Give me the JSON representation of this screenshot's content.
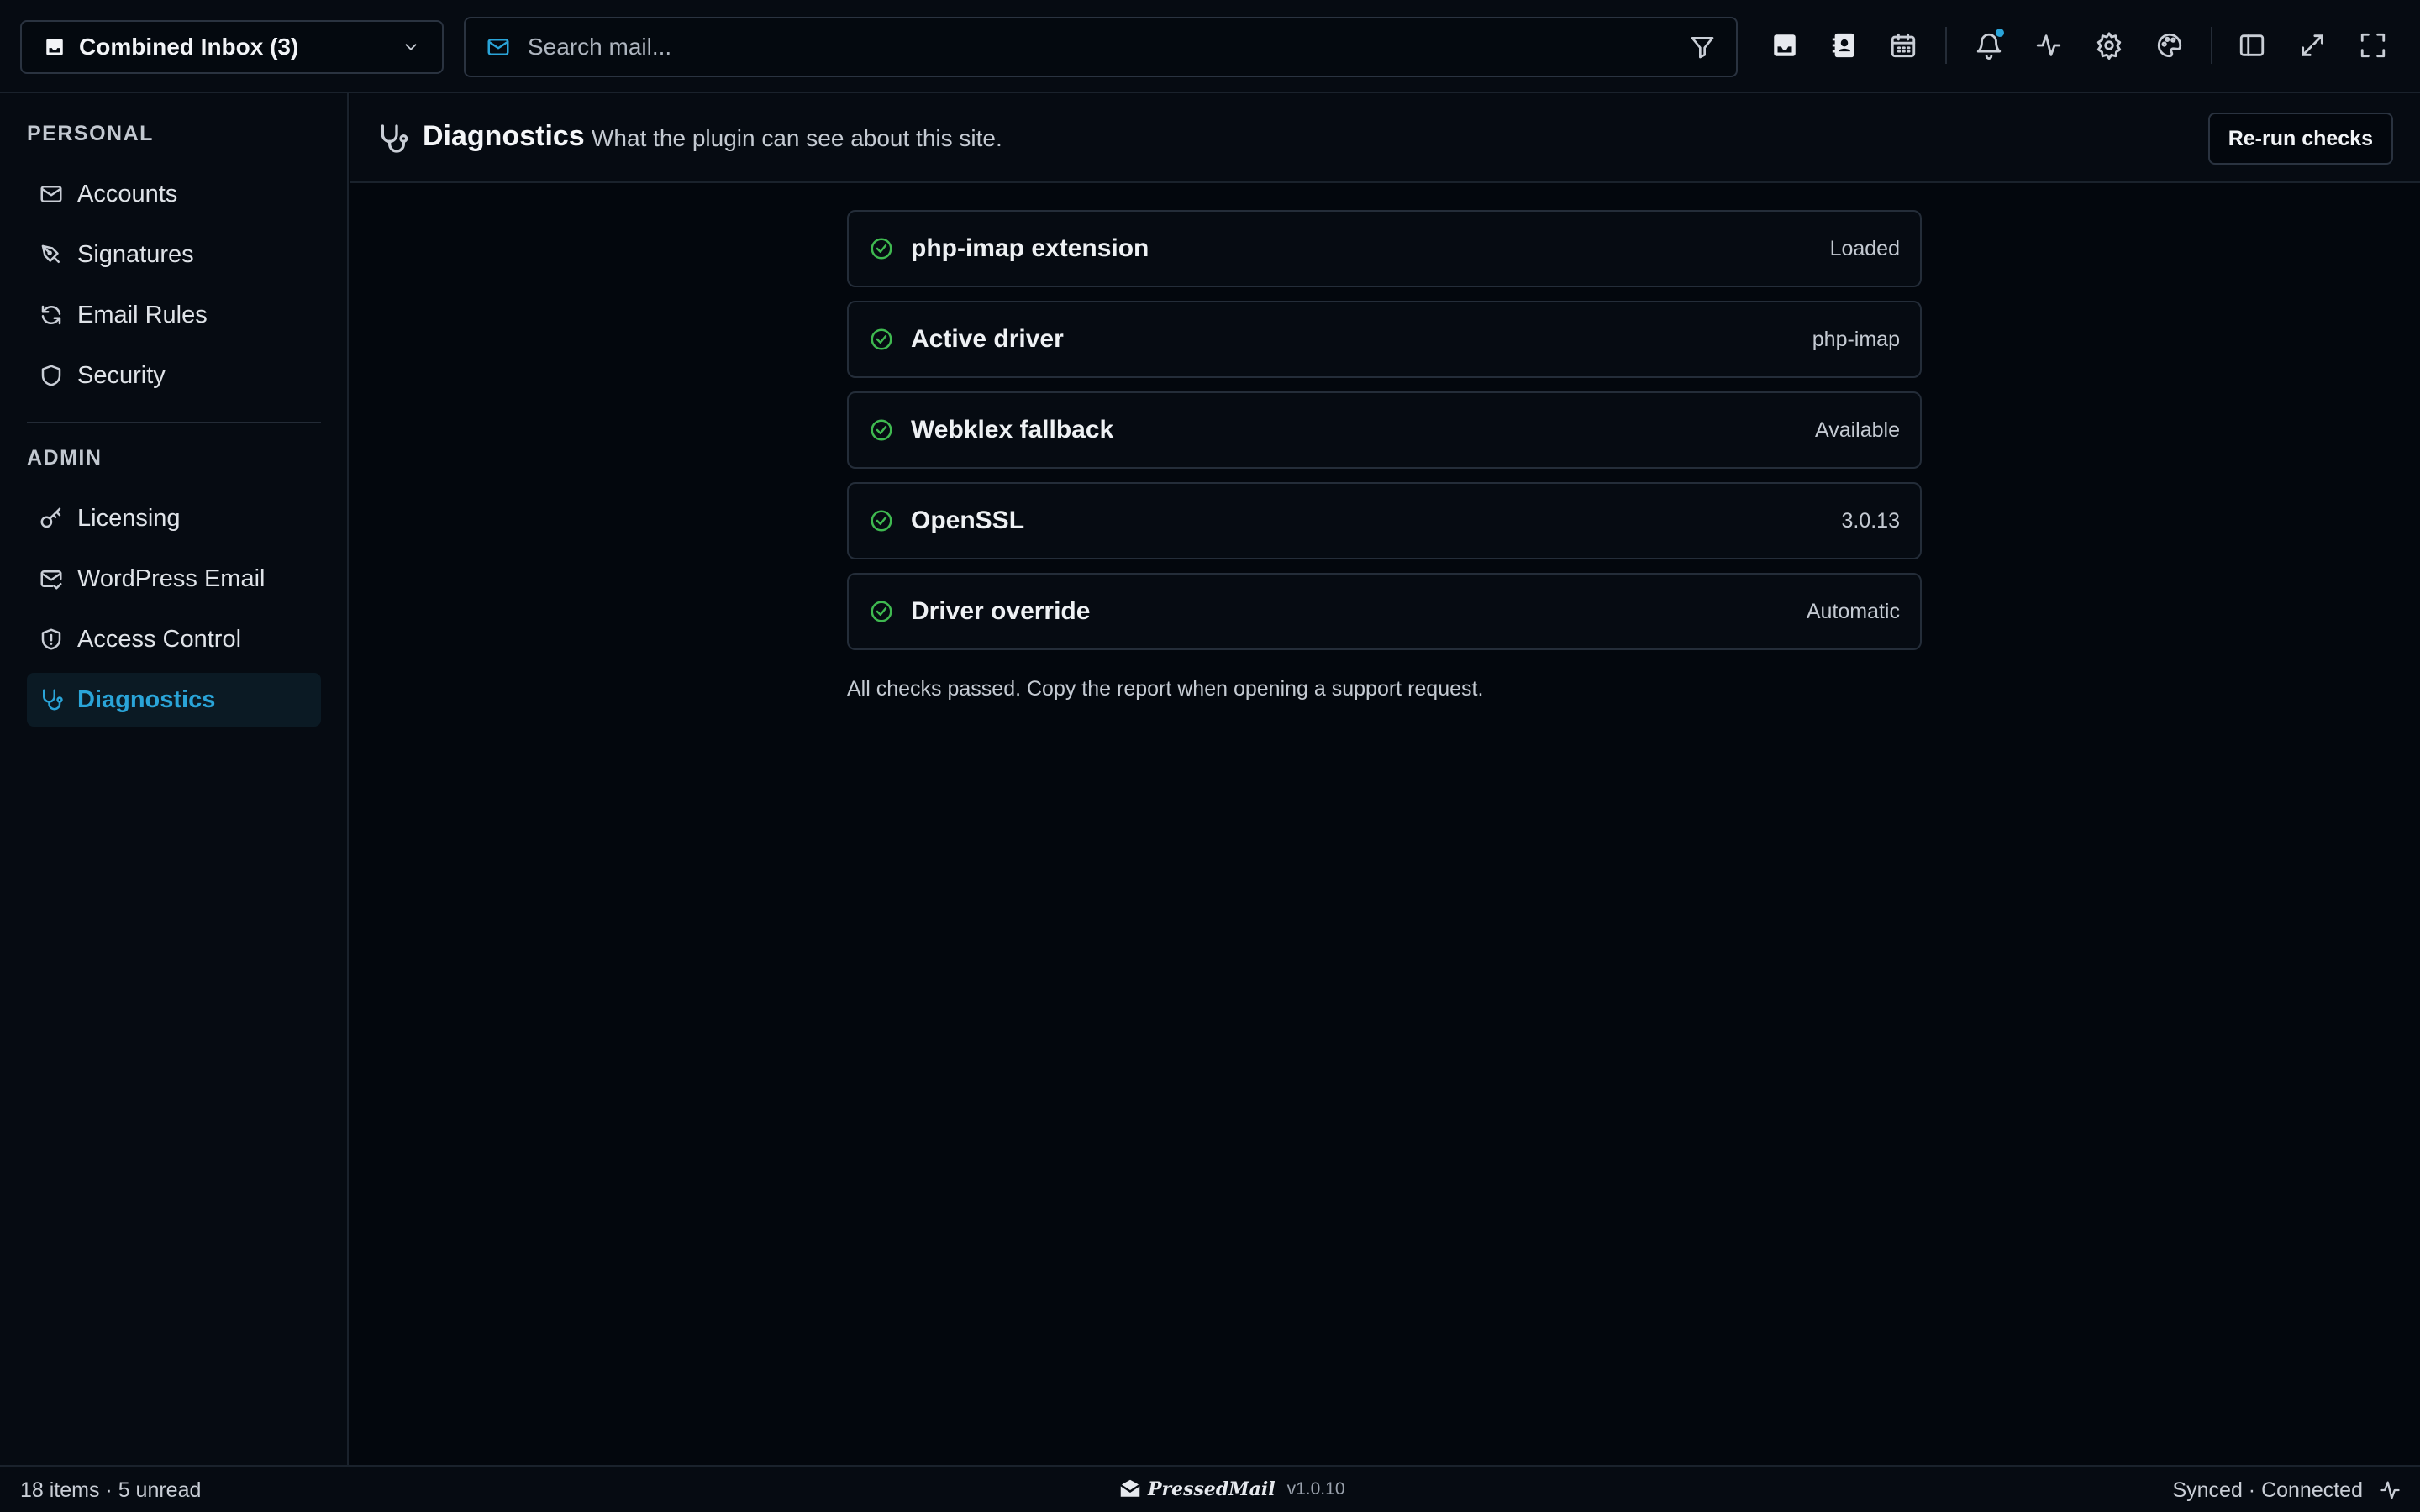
{
  "topbar": {
    "mailbox_label": "Combined Inbox (3)",
    "search_placeholder": "Search mail..."
  },
  "sidebar": {
    "personal_label": "PERSONAL",
    "admin_label": "ADMIN",
    "personal_items": [
      {
        "label": "Accounts",
        "icon": "mail-icon"
      },
      {
        "label": "Signatures",
        "icon": "pen-nib-icon"
      },
      {
        "label": "Email Rules",
        "icon": "refresh-icon"
      },
      {
        "label": "Security",
        "icon": "shield-icon"
      }
    ],
    "admin_items": [
      {
        "label": "Licensing",
        "icon": "key-icon"
      },
      {
        "label": "WordPress Email",
        "icon": "mail-check-icon"
      },
      {
        "label": "Access Control",
        "icon": "shield-alert-icon"
      },
      {
        "label": "Diagnostics",
        "icon": "stethoscope-icon",
        "active": true
      }
    ]
  },
  "header": {
    "title": "Diagnostics",
    "subtitle": "What the plugin can see about this site.",
    "rerun_label": "Re-run checks"
  },
  "checks": [
    {
      "name": "php-imap extension",
      "value": "Loaded",
      "status": "pass"
    },
    {
      "name": "Active driver",
      "value": "php-imap",
      "status": "pass"
    },
    {
      "name": "Webklex fallback",
      "value": "Available",
      "status": "pass"
    },
    {
      "name": "OpenSSL",
      "value": "3.0.13",
      "status": "pass"
    },
    {
      "name": "Driver override",
      "value": "Automatic",
      "status": "pass"
    }
  ],
  "footnote": "All checks passed. Copy the report when opening a support request.",
  "statusbar": {
    "left": "18 items · 5 unread",
    "brand": "PressedMail",
    "version": "v1.0.10",
    "right": "Synced · Connected"
  },
  "colors": {
    "accent": "#2aa4d8",
    "success": "#3fb950",
    "background": "#03070d",
    "panel": "#060b12"
  }
}
